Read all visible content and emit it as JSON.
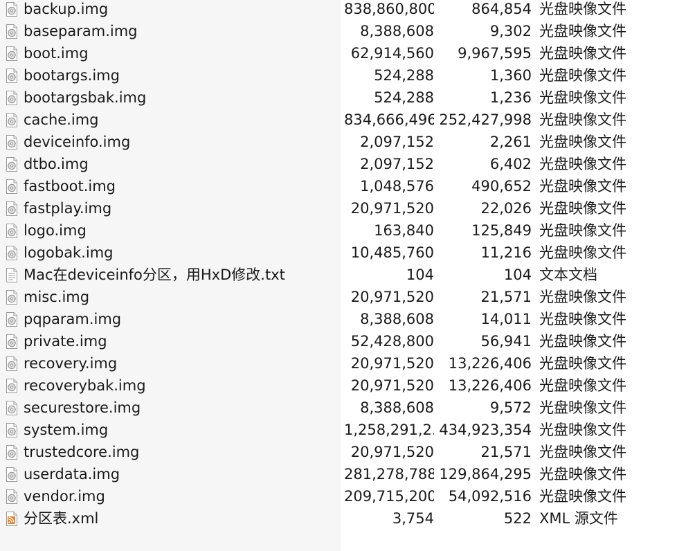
{
  "files": [
    {
      "name": "backup.img",
      "size": "838,860,800",
      "compressed": "864,854",
      "type": "光盘映像文件",
      "icon": "disc-image-file-icon"
    },
    {
      "name": "baseparam.img",
      "size": "8,388,608",
      "compressed": "9,302",
      "type": "光盘映像文件",
      "icon": "disc-image-file-icon"
    },
    {
      "name": "boot.img",
      "size": "62,914,560",
      "compressed": "9,967,595",
      "type": "光盘映像文件",
      "icon": "disc-image-file-icon"
    },
    {
      "name": "bootargs.img",
      "size": "524,288",
      "compressed": "1,360",
      "type": "光盘映像文件",
      "icon": "disc-image-file-icon"
    },
    {
      "name": "bootargsbak.img",
      "size": "524,288",
      "compressed": "1,236",
      "type": "光盘映像文件",
      "icon": "disc-image-file-icon"
    },
    {
      "name": "cache.img",
      "size": "834,666,496",
      "compressed": "252,427,998",
      "type": "光盘映像文件",
      "icon": "disc-image-file-icon"
    },
    {
      "name": "deviceinfo.img",
      "size": "2,097,152",
      "compressed": "2,261",
      "type": "光盘映像文件",
      "icon": "disc-image-file-icon"
    },
    {
      "name": "dtbo.img",
      "size": "2,097,152",
      "compressed": "6,402",
      "type": "光盘映像文件",
      "icon": "disc-image-file-icon"
    },
    {
      "name": "fastboot.img",
      "size": "1,048,576",
      "compressed": "490,652",
      "type": "光盘映像文件",
      "icon": "disc-image-file-icon"
    },
    {
      "name": "fastplay.img",
      "size": "20,971,520",
      "compressed": "22,026",
      "type": "光盘映像文件",
      "icon": "disc-image-file-icon"
    },
    {
      "name": "logo.img",
      "size": "163,840",
      "compressed": "125,849",
      "type": "光盘映像文件",
      "icon": "disc-image-file-icon"
    },
    {
      "name": "logobak.img",
      "size": "10,485,760",
      "compressed": "11,216",
      "type": "光盘映像文件",
      "icon": "disc-image-file-icon"
    },
    {
      "name": "Mac在deviceinfo分区，用HxD修改.txt",
      "size": "104",
      "compressed": "104",
      "type": "文本文档",
      "icon": "text-file-icon"
    },
    {
      "name": "misc.img",
      "size": "20,971,520",
      "compressed": "21,571",
      "type": "光盘映像文件",
      "icon": "disc-image-file-icon"
    },
    {
      "name": "pqparam.img",
      "size": "8,388,608",
      "compressed": "14,011",
      "type": "光盘映像文件",
      "icon": "disc-image-file-icon"
    },
    {
      "name": "private.img",
      "size": "52,428,800",
      "compressed": "56,941",
      "type": "光盘映像文件",
      "icon": "disc-image-file-icon"
    },
    {
      "name": "recovery.img",
      "size": "20,971,520",
      "compressed": "13,226,406",
      "type": "光盘映像文件",
      "icon": "disc-image-file-icon"
    },
    {
      "name": "recoverybak.img",
      "size": "20,971,520",
      "compressed": "13,226,406",
      "type": "光盘映像文件",
      "icon": "disc-image-file-icon"
    },
    {
      "name": "securestore.img",
      "size": "8,388,608",
      "compressed": "9,572",
      "type": "光盘映像文件",
      "icon": "disc-image-file-icon"
    },
    {
      "name": "system.img",
      "size": "1,258,291,2...",
      "compressed": "434,923,354",
      "type": "光盘映像文件",
      "icon": "disc-image-file-icon"
    },
    {
      "name": "trustedcore.img",
      "size": "20,971,520",
      "compressed": "21,571",
      "type": "光盘映像文件",
      "icon": "disc-image-file-icon"
    },
    {
      "name": "userdata.img",
      "size": "281,278,788",
      "compressed": "129,864,295",
      "type": "光盘映像文件",
      "icon": "disc-image-file-icon"
    },
    {
      "name": "vendor.img",
      "size": "209,715,200",
      "compressed": "54,092,516",
      "type": "光盘映像文件",
      "icon": "disc-image-file-icon"
    },
    {
      "name": "分区表.xml",
      "size": "3,754",
      "compressed": "522",
      "type": "XML 源文件",
      "icon": "xml-feed-file-icon"
    }
  ]
}
